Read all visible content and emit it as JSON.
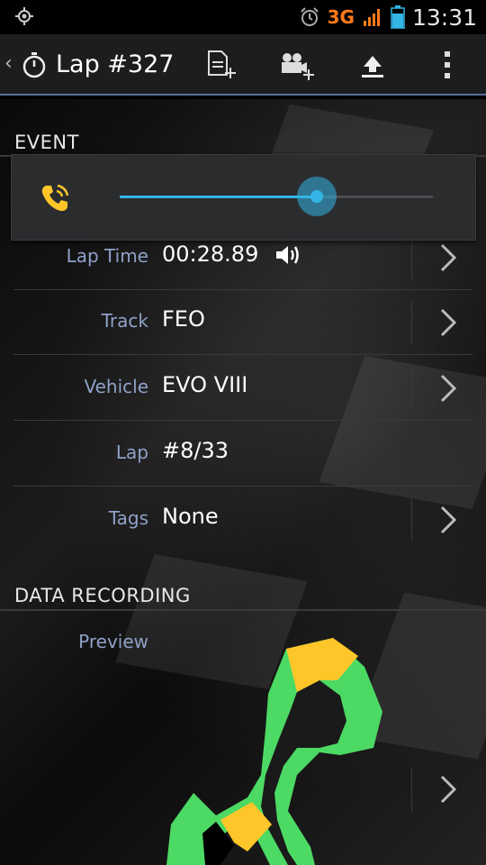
{
  "status_bar": {
    "network": "3G",
    "time": "13:31"
  },
  "action_bar": {
    "title": "Lap #327",
    "icons": [
      "stopwatch-icon",
      "add-document-icon",
      "add-video-icon",
      "upload-icon",
      "overflow-menu-icon"
    ]
  },
  "sections": {
    "event_header": "EVENT",
    "data_recording_header": "DATA RECORDING"
  },
  "volume": {
    "level_percent": 63,
    "accent": "#33b5e5",
    "icon": "phone-volume-icon"
  },
  "event_rows": [
    {
      "label": "Lap Time",
      "value": "00:28.89"
    },
    {
      "label": "Track",
      "value": "FEO"
    },
    {
      "label": "Vehicle",
      "value": "EVO VIII"
    },
    {
      "label": "Lap",
      "value": "#8/33"
    },
    {
      "label": "Tags",
      "value": "None"
    }
  ],
  "data_recording": {
    "preview_label": "Preview"
  },
  "colors": {
    "label": "#8fa1c8",
    "track_green": "#4cd964",
    "track_yellow": "#ffc629"
  }
}
